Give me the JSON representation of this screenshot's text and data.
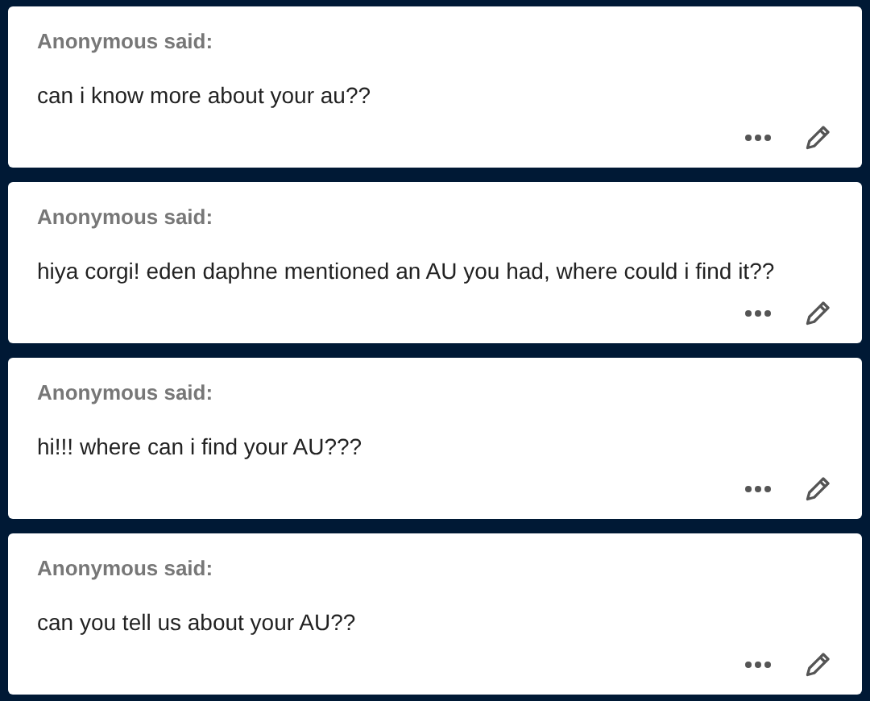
{
  "asks": [
    {
      "asker": "Anonymous said:",
      "question": "can i know more about your au??"
    },
    {
      "asker": "Anonymous said:",
      "question": "hiya corgi! eden daphne mentioned an AU you had, where could i find it??"
    },
    {
      "asker": "Anonymous said:",
      "question": "hi!!! where can i find your AU???"
    },
    {
      "asker": "Anonymous said:",
      "question": "can you tell us about your AU??"
    }
  ]
}
